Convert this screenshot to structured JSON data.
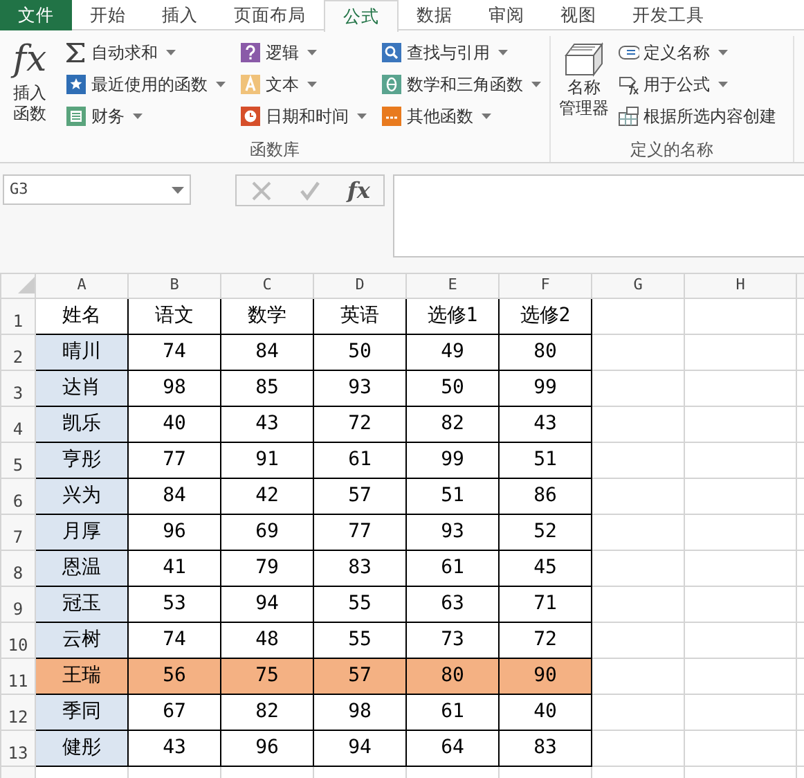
{
  "ribbon_tabs": [
    {
      "label": "文件",
      "kind": "file",
      "selected": false
    },
    {
      "label": "开始",
      "kind": "tab",
      "selected": false
    },
    {
      "label": "插入",
      "kind": "tab",
      "selected": false
    },
    {
      "label": "页面布局",
      "kind": "tab",
      "selected": false
    },
    {
      "label": "公式",
      "kind": "tab",
      "selected": true
    },
    {
      "label": "数据",
      "kind": "tab",
      "selected": false
    },
    {
      "label": "审阅",
      "kind": "tab",
      "selected": false
    },
    {
      "label": "视图",
      "kind": "tab",
      "selected": false
    },
    {
      "label": "开发工具",
      "kind": "tab",
      "selected": false
    }
  ],
  "function_library": {
    "insert_function": {
      "symbol": "fx",
      "label": "插入函数"
    },
    "columns": [
      [
        {
          "label": "自动求和",
          "kind": "sum",
          "dropdown": true
        },
        {
          "label": "最近使用的函数",
          "kind": "recent",
          "dropdown": true
        },
        {
          "label": "财务",
          "kind": "finance",
          "dropdown": true
        }
      ],
      [
        {
          "label": "逻辑",
          "kind": "logic",
          "dropdown": true
        },
        {
          "label": "文本",
          "kind": "text",
          "dropdown": true
        },
        {
          "label": "日期和时间",
          "kind": "date",
          "dropdown": true
        }
      ],
      [
        {
          "label": "查找与引用",
          "kind": "lookup",
          "dropdown": true
        },
        {
          "label": "数学和三角函数",
          "kind": "math",
          "dropdown": true
        },
        {
          "label": "其他函数",
          "kind": "other",
          "dropdown": true
        }
      ]
    ],
    "title": "函数库"
  },
  "defined_names": {
    "name_manager": [
      "名称",
      "管理器"
    ],
    "items": [
      {
        "label": "定义名称",
        "kind": "define",
        "dropdown": true
      },
      {
        "label": "用于公式",
        "kind": "use",
        "dropdown": true
      },
      {
        "label": "根据所选内容创建",
        "kind": "create",
        "dropdown": false
      }
    ],
    "title": "定义的名称"
  },
  "formula_bar": {
    "name_box": "G3",
    "fx": "fx"
  },
  "sheet": {
    "columns": [
      "A",
      "B",
      "C",
      "D",
      "E",
      "F",
      "G",
      "H"
    ],
    "rows": [
      {
        "header": "1",
        "highlighted": false,
        "cells": [
          "姓名",
          "语文",
          "数学",
          "英语",
          "选修1",
          "选修2"
        ]
      },
      {
        "header": "2",
        "highlighted": false,
        "cells": [
          "晴川",
          "74",
          "84",
          "50",
          "49",
          "80"
        ]
      },
      {
        "header": "3",
        "highlighted": false,
        "cells": [
          "达肖",
          "98",
          "85",
          "93",
          "50",
          "99"
        ]
      },
      {
        "header": "4",
        "highlighted": false,
        "cells": [
          "凯乐",
          "40",
          "43",
          "72",
          "82",
          "43"
        ]
      },
      {
        "header": "5",
        "highlighted": false,
        "cells": [
          "亨彤",
          "77",
          "91",
          "61",
          "99",
          "51"
        ]
      },
      {
        "header": "6",
        "highlighted": false,
        "cells": [
          "兴为",
          "84",
          "42",
          "57",
          "51",
          "86"
        ]
      },
      {
        "header": "7",
        "highlighted": false,
        "cells": [
          "月厚",
          "96",
          "69",
          "77",
          "93",
          "52"
        ]
      },
      {
        "header": "8",
        "highlighted": false,
        "cells": [
          "恩温",
          "41",
          "79",
          "83",
          "61",
          "45"
        ]
      },
      {
        "header": "9",
        "highlighted": false,
        "cells": [
          "冠玉",
          "53",
          "94",
          "55",
          "63",
          "71"
        ]
      },
      {
        "header": "10",
        "highlighted": false,
        "cells": [
          "云树",
          "74",
          "48",
          "55",
          "73",
          "72"
        ]
      },
      {
        "header": "11",
        "highlighted": true,
        "cells": [
          "王瑞",
          "56",
          "75",
          "57",
          "80",
          "90"
        ]
      },
      {
        "header": "12",
        "highlighted": false,
        "cells": [
          "季同",
          "67",
          "82",
          "98",
          "61",
          "40"
        ]
      },
      {
        "header": "13",
        "highlighted": false,
        "cells": [
          "健彤",
          "43",
          "96",
          "94",
          "64",
          "83"
        ]
      }
    ]
  }
}
